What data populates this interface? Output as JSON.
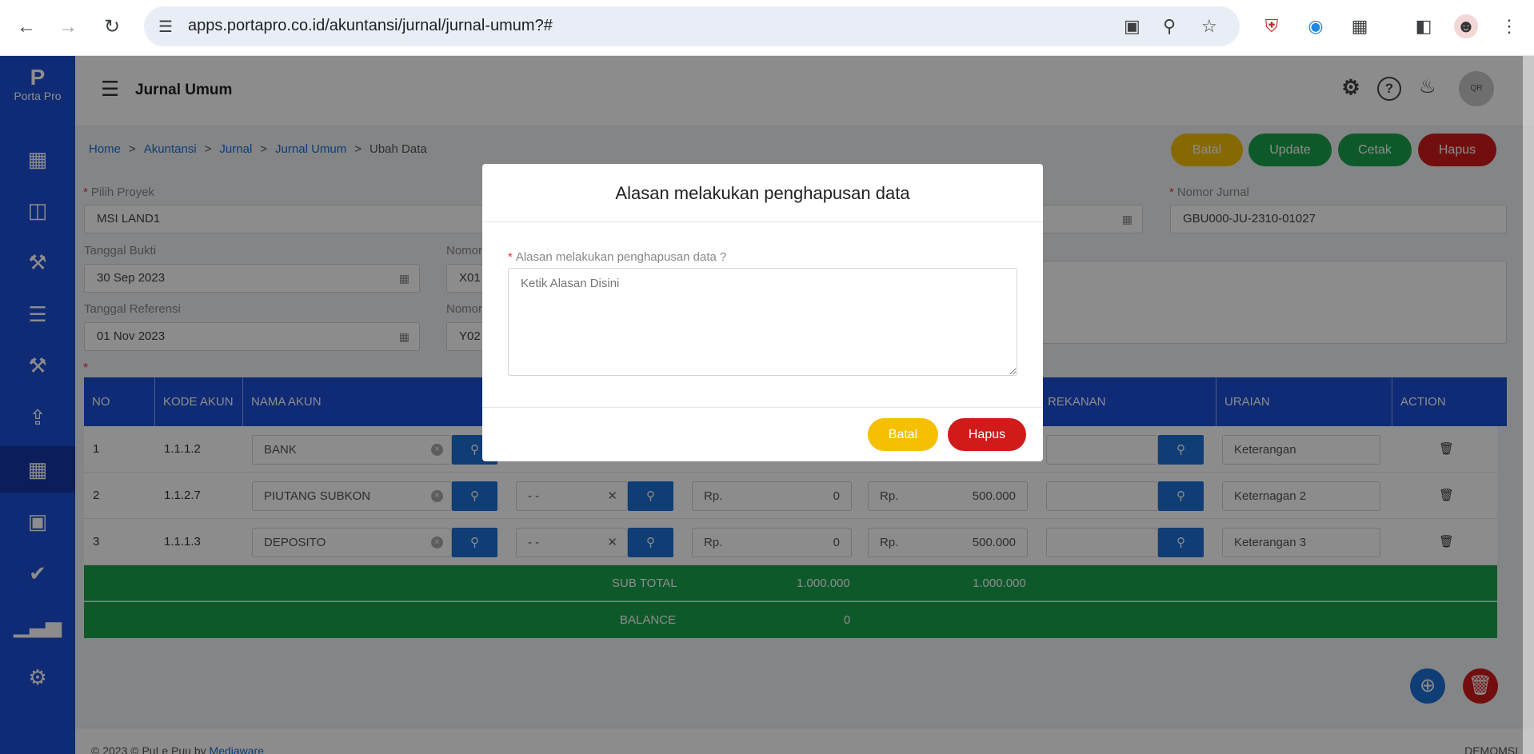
{
  "browser": {
    "url": "apps.portapro.co.id/akuntansi/jurnal/jurnal-umum?#"
  },
  "brand": {
    "mark": "P",
    "name": "Porta Pro"
  },
  "sidebar": {
    "items": [
      {
        "icon": "dashboard-icon"
      },
      {
        "icon": "network-icon"
      },
      {
        "icon": "hammer-icon"
      },
      {
        "icon": "clipboard-icon"
      },
      {
        "icon": "tools-icon"
      },
      {
        "icon": "finance-icon"
      },
      {
        "icon": "accounting-icon"
      },
      {
        "icon": "package-icon"
      },
      {
        "icon": "check-badge-icon"
      },
      {
        "icon": "chart-icon"
      },
      {
        "icon": "gears-icon"
      }
    ],
    "active_index": 6
  },
  "header": {
    "title": "Jurnal Umum",
    "avatar_text": "QR"
  },
  "breadcrumb": {
    "items": [
      "Home",
      "Akuntansi",
      "Jurnal",
      "Jurnal Umum"
    ],
    "current": "Ubah Data",
    "sep": ">"
  },
  "actions": {
    "batal": "Batal",
    "update": "Update",
    "cetak": "Cetak",
    "hapus": "Hapus"
  },
  "colors": {
    "primary": "#1d4fd6",
    "success": "#1aa34e",
    "warning": "#f5c000",
    "danger": "#d11a1a"
  },
  "form": {
    "proyek_label": "Pilih Proyek",
    "proyek_value": "MSI LAND1",
    "nomor_jurnal_label": "Nomor Jurnal",
    "nomor_jurnal_value": "GBU000-JU-2310-01027",
    "tanggal_bukti_label": "Tanggal Bukti",
    "tanggal_bukti_value": "30 Sep 2023",
    "nomor_bukti_label": "Nomor",
    "nomor_bukti_value": "X01",
    "tanggal_referensi_label": "Tanggal Referensi",
    "tanggal_referensi_value": "01 Nov 2023",
    "nomor_referensi_label": "Nomor",
    "nomor_referensi_value": "Y02"
  },
  "table": {
    "headers": {
      "no": "NO",
      "kode_akun": "KODE AKUN",
      "nama_akun": "NAMA AKUN",
      "rekanan": "REKANAN",
      "uraian": "URAIAN",
      "action": "ACTION"
    },
    "rows": [
      {
        "no": "1",
        "kode": "1.1.1.2",
        "nama": "BANK",
        "sub": "",
        "rp": "Rp.",
        "debit": "",
        "kredit": "",
        "uraian": "Keterangan"
      },
      {
        "no": "2",
        "kode": "1.1.2.7",
        "nama": "PIUTANG SUBKON",
        "sub": "- -",
        "rp": "Rp.",
        "debit": "0",
        "kredit": "500.000",
        "uraian": "Keternagan 2"
      },
      {
        "no": "3",
        "kode": "1.1.1.3",
        "nama": "DEPOSITO",
        "sub": "- -",
        "rp": "Rp.",
        "debit": "0",
        "kredit": "500.000",
        "uraian": "Keterangan 3"
      }
    ],
    "subtotal_label": "SUB TOTAL",
    "subtotal_debit": "1.000.000",
    "subtotal_kredit": "1.000.000",
    "balance_label": "BALANCE",
    "balance_value": "0"
  },
  "footer": {
    "left": "2023 © PuLe Puu by",
    "link": "Mediaware",
    "right": "DEMOMSI"
  },
  "modal": {
    "title": "Alasan melakukan penghapusan data",
    "label": "Alasan melakukan penghapusan data ?",
    "placeholder": "Ketik Alasan Disini",
    "cancel": "Batal",
    "confirm": "Hapus"
  }
}
